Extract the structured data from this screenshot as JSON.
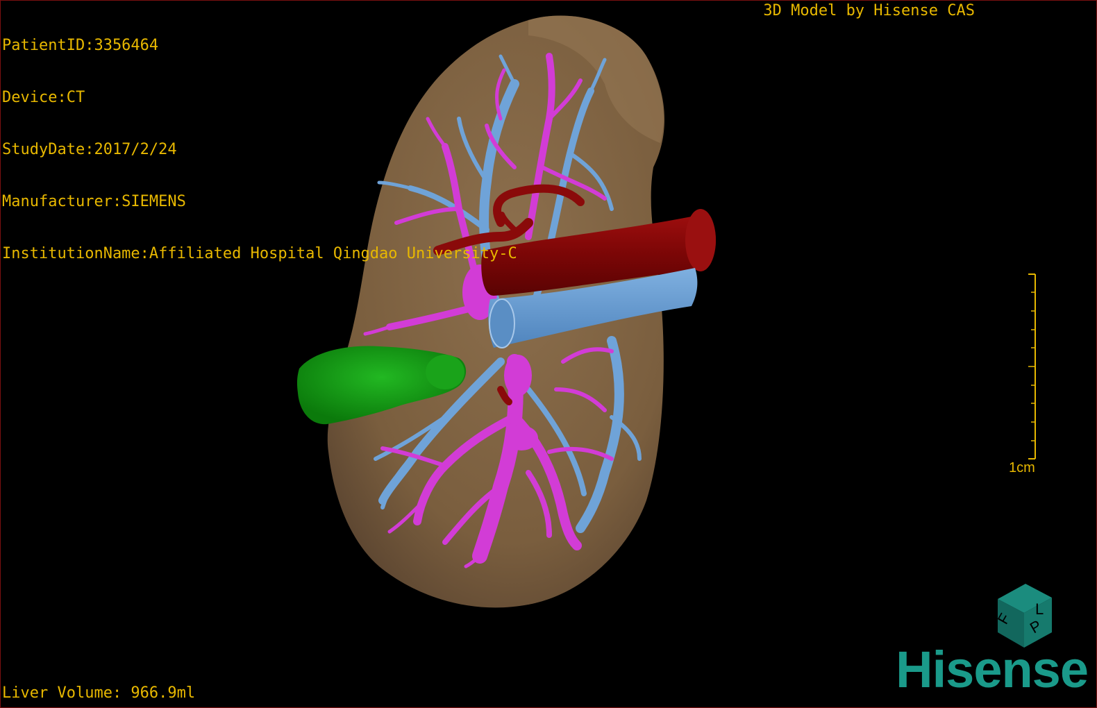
{
  "info": {
    "patient_id": "PatientID:3356464",
    "device": "Device:CT",
    "study_date": "StudyDate:2017/2/24",
    "manufacturer": "Manufacturer:SIEMENS",
    "institution": "InstitutionName:Affiliated Hospital Qingdao University-C"
  },
  "credit": "3D Model by Hisense CAS",
  "liver_volume": "Liver Volume: 966.9ml",
  "scale_bar": {
    "label": "1cm"
  },
  "brand": "Hisense",
  "orientation_cube": {
    "face_top": "F",
    "face_right": "L",
    "face_side": "P"
  },
  "colors": {
    "text": "#e8b800",
    "liver": "#7d6140",
    "portal_vein": "#d23cd6",
    "hepatic_vein": "#6fa3d8",
    "artery_vena": "#8a0a0a",
    "lesion": "#1aa31a",
    "brand": "#1a9a8a"
  }
}
